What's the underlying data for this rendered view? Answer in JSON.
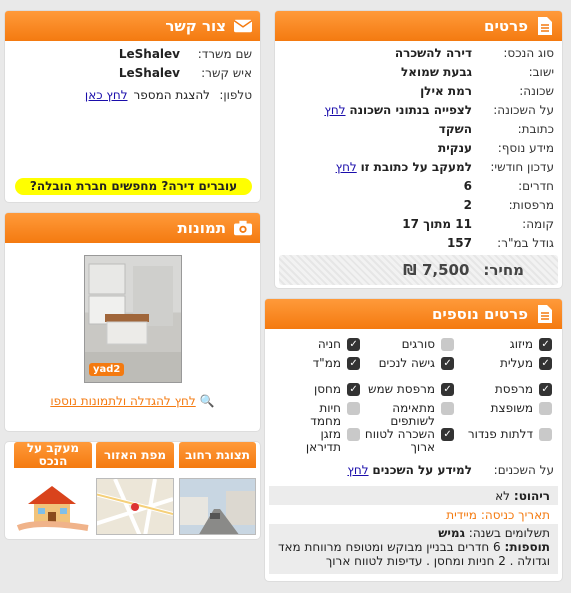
{
  "details": {
    "title": "פרטים",
    "rows": [
      {
        "label": "סוג הנכס:",
        "value": "דירה להשכרה"
      },
      {
        "label": "ישוב:",
        "value": "גבעת שמואל"
      },
      {
        "label": "שכונה:",
        "value": "רמת אילן"
      },
      {
        "label": "על השכונה:",
        "value": "לצפייה בנתוני השכונה",
        "link": "לחץ"
      },
      {
        "label": "כתובת:",
        "value": "השקד"
      },
      {
        "label": "מידע נוסף:",
        "value": "ענקית"
      },
      {
        "label": "עדכון חודשי:",
        "value": "למעקב על כתובת זו",
        "link": "לחץ"
      },
      {
        "label": "חדרים:",
        "value": "6"
      },
      {
        "label": "מרפסות:",
        "value": "2"
      },
      {
        "label": "קומה:",
        "value": "11 מתוך 17"
      },
      {
        "label": "גודל במ\"ר:",
        "value": "157"
      }
    ],
    "price_label": "מחיר:",
    "price_value": "7,500 ₪"
  },
  "contact": {
    "title": "צור קשר",
    "office_label": "שם משרד:",
    "office_value": "LeShalev",
    "person_label": "איש קשר:",
    "person_value": "LeShalev",
    "phone_label": "טלפון:",
    "phone_text": "להצגת המספר",
    "phone_link": "לחץ כאן",
    "banner": "עוברים דירה? מחפשים חברת הובלה?"
  },
  "photos": {
    "title": "תמונות",
    "watermark": "yad2",
    "enlarge_link": "לחץ להגדלה ולתמונות נוספו"
  },
  "tabs": [
    {
      "label": "תצוגת רחוב"
    },
    {
      "label": "מפת האזור"
    },
    {
      "label": "מעקב על הנכס"
    }
  ],
  "extras": {
    "title": "פרטים נוספים",
    "items": [
      {
        "label": "מיזוג",
        "checked": true
      },
      {
        "label": "סורגים",
        "checked": false
      },
      {
        "label": "חניה",
        "checked": true
      },
      {
        "label": "מעלית",
        "checked": true
      },
      {
        "label": "גישה לנכים",
        "checked": true
      },
      {
        "label": "ממ\"ד",
        "checked": true
      },
      {
        "label": "מרפסת",
        "checked": true
      },
      {
        "label": "מרפסת שמש",
        "checked": true
      },
      {
        "label": "מחסן",
        "checked": true
      },
      {
        "label": "משופצת",
        "checked": false
      },
      {
        "label": "מתאימה לשותפים",
        "checked": false
      },
      {
        "label": "חיות מחמד",
        "checked": false
      },
      {
        "label": "דלתות פנדור",
        "checked": false
      },
      {
        "label": "השכרה לטווח ארוך",
        "checked": true
      },
      {
        "label": "מזגן תדיראן",
        "checked": false
      }
    ],
    "neighbors_label": "על השכנים:",
    "neighbors_value": "למידע על השכנים",
    "neighbors_link": "לחץ",
    "furniture_label": "ריהוט:",
    "furniture_value": "לא",
    "entry_label": "תאריך כניסה:",
    "entry_value": "מיידית",
    "payments_label": "תשלומים בשנה:",
    "payments_value": "גמיש",
    "additions_label": "תוספות:",
    "additions_value": "6 חדרים בבניין מבוקש ומטופח מרווחת מאד וגדולה . 2 חניות ומחסן . עדיפות לטווח ארוך"
  },
  "colors": {
    "accent": "#f47a10",
    "banner": "#ffff00",
    "link": "#1a0dab"
  }
}
